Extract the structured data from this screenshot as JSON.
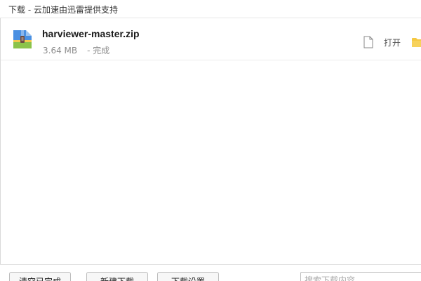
{
  "window": {
    "title": "下载 - 云加速由迅雷提供支持"
  },
  "downloads": [
    {
      "icon": "zip-archive-icon",
      "filename": "harviewer-master.zip",
      "size": "3.64 MB",
      "status": "- 完成",
      "open_label": "打开"
    }
  ],
  "footer": {
    "clear_label": "清空已完成",
    "new_label": "新建下载",
    "settings_label": "下载设置",
    "search_placeholder": "搜索下载内容"
  },
  "colors": {
    "archive_blue": "#4a90e2",
    "archive_yellow": "#f2c94c",
    "folder_yellow": "#f5c842"
  }
}
